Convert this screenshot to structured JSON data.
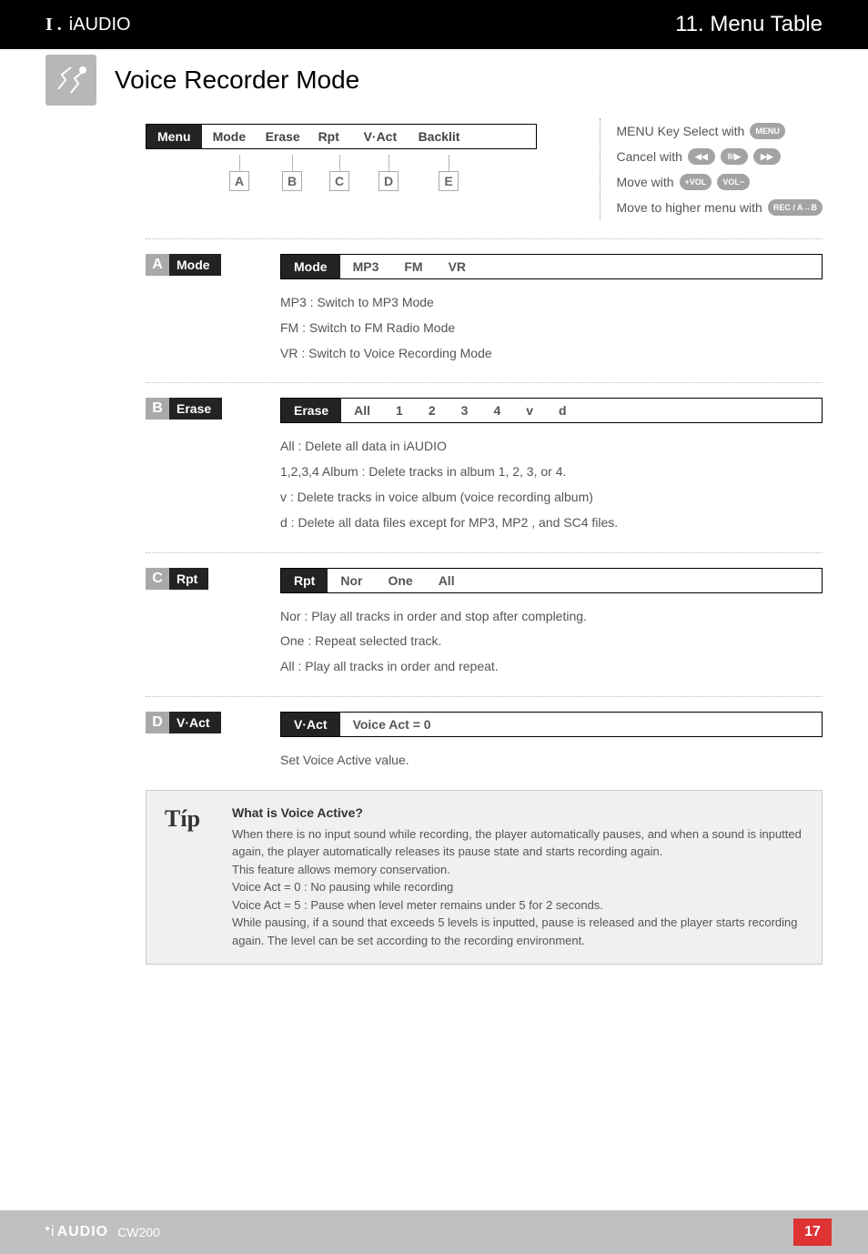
{
  "header": {
    "chapter_left": "iAUDIO",
    "chapter_roman": "I .",
    "chapter_right": "11. Menu Table"
  },
  "mode": {
    "title": "Voice Recorder Mode"
  },
  "menubar": {
    "items": [
      "Menu",
      "Mode",
      "Erase",
      "Rpt",
      "V·Act",
      "Backlit"
    ],
    "letters": [
      "A",
      "B",
      "C",
      "D",
      "E"
    ]
  },
  "legend": {
    "l1_pre": "MENU Key Select with",
    "l1_pill": "MENU",
    "l2_pre": "Cancel with",
    "l2_p1": "◀◀",
    "l2_p2": "II/▶",
    "l2_p3": "▶▶",
    "l3_pre": "Move with",
    "l3_p1": "+VOL",
    "l3_p2": "VOL−",
    "l4_pre": "Move to higher menu with",
    "l4_pill": "REC / A↔B"
  },
  "sections": {
    "A": {
      "letter": "A",
      "label": "Mode",
      "bar": [
        "Mode",
        "MP3",
        "FM",
        "VR"
      ],
      "desc": [
        "MP3 : Switch to MP3 Mode",
        "FM : Switch to FM Radio Mode",
        "VR : Switch to Voice Recording Mode"
      ]
    },
    "B": {
      "letter": "B",
      "label": "Erase",
      "bar": [
        "Erase",
        "All",
        "1",
        "2",
        "3",
        "4",
        "v",
        "d"
      ],
      "desc": [
        "All : Delete all data in iAUDIO",
        "1,2,3,4 Album : Delete tracks in album 1, 2, 3, or 4.",
        "v : Delete tracks in voice album (voice recording album)",
        "d : Delete all data files except for MP3, MP2 , and SC4 files."
      ]
    },
    "C": {
      "letter": "C",
      "label": "Rpt",
      "bar": [
        "Rpt",
        "Nor",
        "One",
        "All"
      ],
      "desc": [
        "Nor : Play all tracks in order and stop after completing.",
        "One : Repeat selected track.",
        "All : Play all tracks in order and repeat."
      ]
    },
    "D": {
      "letter": "D",
      "label": "V·Act",
      "bar": [
        "V·Act",
        "Voice Act = 0"
      ],
      "desc": [
        "Set Voice Active value."
      ]
    }
  },
  "tip": {
    "label": "Típ",
    "heading": "What is Voice Active?",
    "body": "When there is no input sound while recording, the player automatically pauses, and when a sound is inputted again, the player automatically releases its pause state and starts recording again.\nThis feature allows memory conservation.\nVoice Act = 0 : No pausing while recording\nVoice Act = 5 : Pause when level meter remains under 5 for 2 seconds.\nWhile pausing, if a sound that exceeds 5 levels is inputted, pause is released and the player starts recording again. The level can be set according to the recording environment."
  },
  "footer": {
    "model": "CW200",
    "page": "17",
    "brand_i": "i",
    "brand_rest": "AUDIO"
  }
}
